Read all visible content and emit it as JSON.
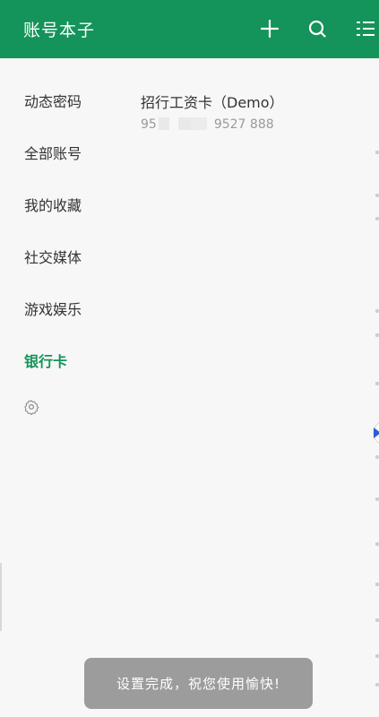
{
  "appbar": {
    "title": "账号本子",
    "icons": [
      "plus-icon",
      "search-icon",
      "list-menu-icon"
    ]
  },
  "sidebar": {
    "items": [
      {
        "label": "动态密码",
        "active": false
      },
      {
        "label": "全部账号",
        "active": false
      },
      {
        "label": "我的收藏",
        "active": false
      },
      {
        "label": "社交媒体",
        "active": false
      },
      {
        "label": "游戏娱乐",
        "active": false
      },
      {
        "label": "银行卡",
        "active": true
      }
    ],
    "settings_icon": "gear-icon"
  },
  "content": {
    "items": [
      {
        "name": "招行工资卡（Demo）",
        "number_prefix": "95",
        "number_suffix": "9527 888"
      }
    ]
  },
  "toast": {
    "message": "设置完成，祝您使用愉快!"
  },
  "colors": {
    "brand": "#14935a",
    "background": "#f7f7f7",
    "toast_bg": "#9c9c9c",
    "accent_blue": "#2f5bd6"
  }
}
